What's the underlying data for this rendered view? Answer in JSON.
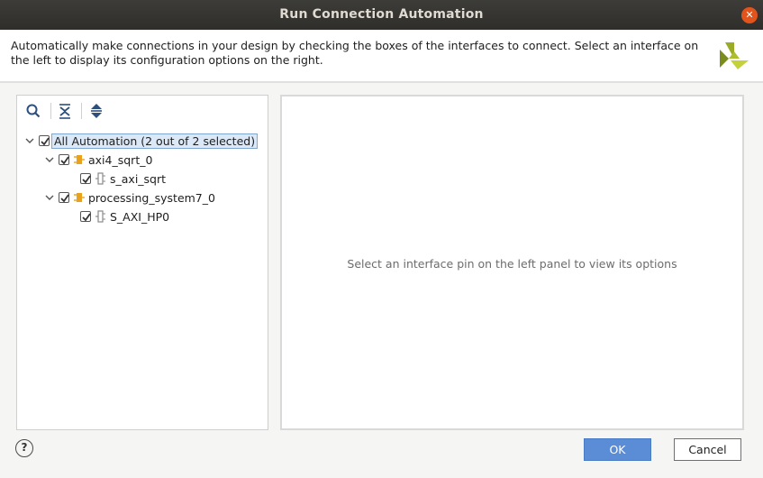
{
  "window": {
    "title": "Run Connection Automation",
    "close_glyph": "✕"
  },
  "header": {
    "description": "Automatically make connections in your design by checking the boxes of the interfaces to connect. Select an interface on the left to display its configuration options on the right."
  },
  "toolbar": {
    "icons": [
      "search-icon",
      "collapse-all-icon",
      "expand-all-icon"
    ]
  },
  "tree": {
    "root": {
      "label": "All Automation (2 out of 2 selected)",
      "checked": true,
      "expanded": true
    },
    "items": [
      {
        "label": "axi4_sqrt_0",
        "checked": true,
        "expanded": true,
        "icon": "ip-block-icon",
        "children": [
          {
            "label": "s_axi_sqrt",
            "checked": true,
            "icon": "interface-pin-icon"
          }
        ]
      },
      {
        "label": "processing_system7_0",
        "checked": true,
        "expanded": true,
        "icon": "ip-block-icon",
        "children": [
          {
            "label": "S_AXI_HP0",
            "checked": true,
            "icon": "interface-pin-icon"
          }
        ]
      }
    ]
  },
  "right_panel": {
    "hint": "Select an interface pin on the left panel to view its options"
  },
  "footer": {
    "help_label": "?",
    "ok_label": "OK",
    "cancel_label": "Cancel"
  },
  "colors": {
    "titlebar": "#2f2e2b",
    "close": "#e2541b",
    "ok_button": "#5b8dd6",
    "logo_dark": "#7b8c1e",
    "logo_light": "#c5d13a",
    "ip_icon": "#e8a21e"
  }
}
